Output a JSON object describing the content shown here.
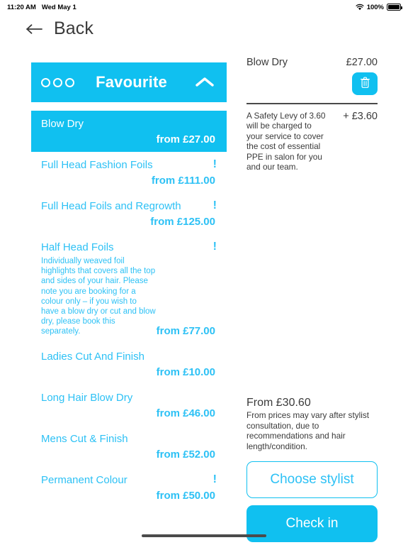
{
  "status_bar": {
    "time": "11:20 AM",
    "date": "Wed May 1",
    "wifi_icon": "wifi-icon",
    "battery_percent": "100%",
    "battery_icon": "battery-full-icon"
  },
  "nav": {
    "back_icon": "arrow-left-icon",
    "back_label": "Back"
  },
  "category": {
    "menu_icon": "three-circles-icon",
    "title": "Favourite",
    "collapse_icon": "chevron-up-icon"
  },
  "services": [
    {
      "name": "Blow Dry",
      "price": "from £27.00",
      "selected": true,
      "warning": "",
      "description": ""
    },
    {
      "name": "Full Head Fashion Foils",
      "price": "from £111.00",
      "selected": false,
      "warning": "!",
      "description": ""
    },
    {
      "name": "Full Head Foils and Regrowth",
      "price": "from £125.00",
      "selected": false,
      "warning": "!",
      "description": ""
    },
    {
      "name": "Half Head Foils",
      "price": "from £77.00",
      "selected": false,
      "warning": "!",
      "description": "Individually weaved foil highlights that covers all the top and sides of your hair. Please note you are booking for a colour only – if you wish to have a blow dry or cut and blow dry, please book this separately."
    },
    {
      "name": "Ladies Cut And Finish",
      "price": "from £10.00",
      "selected": false,
      "warning": "",
      "description": ""
    },
    {
      "name": "Long Hair Blow Dry",
      "price": "from £46.00",
      "selected": false,
      "warning": "",
      "description": ""
    },
    {
      "name": "Mens Cut & Finish",
      "price": "from £52.00",
      "selected": false,
      "warning": "",
      "description": ""
    },
    {
      "name": "Permanent Colour",
      "price": "from £50.00",
      "selected": false,
      "warning": "!",
      "description": ""
    }
  ],
  "basket": {
    "item_name": "Blow Dry",
    "item_price": "£27.00",
    "delete_icon": "trash-icon",
    "levy_text": "A Safety Levy of 3.60 will be charged to your service to cover the cost of essential PPE in salon for you and our team.",
    "levy_amount": "+ £3.60"
  },
  "footer": {
    "total_label": "From £30.60",
    "note": "From prices may vary after stylist consultation, due to recommendations and hair length/condition.",
    "choose_stylist_label": "Choose stylist",
    "check_in_label": "Check in"
  },
  "colors": {
    "accent": "#10c0f0",
    "accent_text": "#2dc1f5",
    "text_dark": "#3a3a3a"
  }
}
